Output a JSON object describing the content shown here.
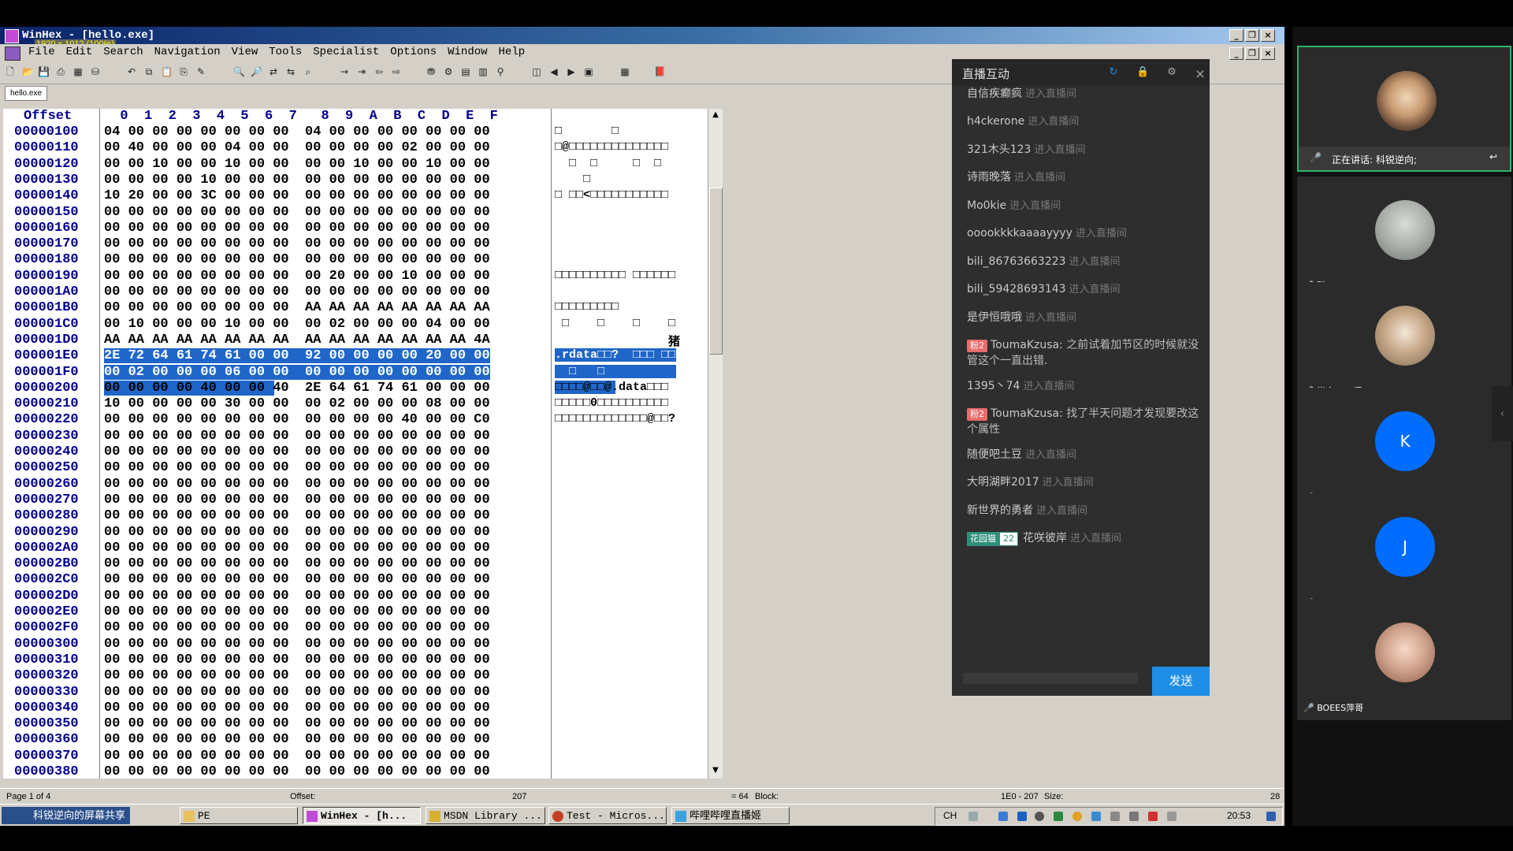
{
  "window": {
    "title": "WinHex - [hello.exe]",
    "size_info": "1920 x 1012 (100%)",
    "min": "_",
    "restore": "❐",
    "close": "×"
  },
  "menu": [
    "File",
    "Edit",
    "Search",
    "Navigation",
    "View",
    "Tools",
    "Specialist",
    "Options",
    "Window",
    "Help"
  ],
  "tab": "hello.exe",
  "hex_header": "Offset",
  "hex_columns": "  0  1  2  3  4  5  6  7   8  9  A  B  C  D  E  F",
  "rows": [
    {
      "off": "00000100",
      "hex": "04 00 00 00 00 00 00 00  04 00 00 00 00 00 00 00",
      "asc": "□       □"
    },
    {
      "off": "00000110",
      "hex": "00 40 00 00 00 04 00 00  00 00 00 00 02 00 00 00",
      "asc": "□@□□□□□□□□□□□□□□"
    },
    {
      "off": "00000120",
      "hex": "00 00 10 00 00 10 00 00  00 00 10 00 00 10 00 00",
      "asc": "  □  □     □  □"
    },
    {
      "off": "00000130",
      "hex": "00 00 00 00 10 00 00 00  00 00 00 00 00 00 00 00",
      "asc": "    □"
    },
    {
      "off": "00000140",
      "hex": "10 20 00 00 3C 00 00 00  00 00 00 00 00 00 00 00",
      "asc": "□ □□<□□□□□□□□□□□"
    },
    {
      "off": "00000150",
      "hex": "00 00 00 00 00 00 00 00  00 00 00 00 00 00 00 00",
      "asc": ""
    },
    {
      "off": "00000160",
      "hex": "00 00 00 00 00 00 00 00  00 00 00 00 00 00 00 00",
      "asc": ""
    },
    {
      "off": "00000170",
      "hex": "00 00 00 00 00 00 00 00  00 00 00 00 00 00 00 00",
      "asc": ""
    },
    {
      "off": "00000180",
      "hex": "00 00 00 00 00 00 00 00  00 00 00 00 00 00 00 00",
      "asc": ""
    },
    {
      "off": "00000190",
      "hex": "00 00 00 00 00 00 00 00  00 20 00 00 10 00 00 00",
      "asc": "□□□□□□□□□□ □□□□□□"
    },
    {
      "off": "000001A0",
      "hex": "00 00 00 00 00 00 00 00  00 00 00 00 00 00 00 00",
      "asc": ""
    },
    {
      "off": "000001B0",
      "hex": "00 00 00 00 00 00 00 00  AA AA AA AA AA AA AA AA",
      "asc": "□□□□□□□□□"
    },
    {
      "off": "000001C0",
      "hex": "00 10 00 00 00 10 00 00  00 02 00 00 00 04 00 00",
      "asc": " □    □    □    □"
    },
    {
      "off": "000001D0",
      "hex": "AA AA AA AA AA AA AA AA  AA AA AA AA AA AA AA 4A",
      "asc": "                猪"
    },
    {
      "off": "000001E0",
      "hex": "2E 72 64 61 74 61 00 00  92 00 00 00 00 20 00 00",
      "asc": ".rdata□□?  □□□ □□"
    },
    {
      "off": "000001F0",
      "hex": "00 02 00 00 00 06 00 00  00 00 00 00 00 00 00 00",
      "asc": "  □   □"
    },
    {
      "off": "00000200",
      "hex": "00 00 00 00 40 00 00 40  2E 64 61 74 61 00 00 00",
      "asc": "□□□□@□□@.data□□□"
    },
    {
      "off": "00000210",
      "hex": "10 00 00 00 00 30 00 00  00 02 00 00 00 08 00 00",
      "asc": "□□□□□0□□□□□□□□□□"
    },
    {
      "off": "00000220",
      "hex": "00 00 00 00 00 00 00 00  00 00 00 00 40 00 00 C0",
      "asc": "□□□□□□□□□□□□□@□□?"
    },
    {
      "off": "00000230",
      "hex": "00 00 00 00 00 00 00 00  00 00 00 00 00 00 00 00",
      "asc": ""
    },
    {
      "off": "00000240",
      "hex": "00 00 00 00 00 00 00 00  00 00 00 00 00 00 00 00",
      "asc": ""
    },
    {
      "off": "00000250",
      "hex": "00 00 00 00 00 00 00 00  00 00 00 00 00 00 00 00",
      "asc": ""
    },
    {
      "off": "00000260",
      "hex": "00 00 00 00 00 00 00 00  00 00 00 00 00 00 00 00",
      "asc": ""
    },
    {
      "off": "00000270",
      "hex": "00 00 00 00 00 00 00 00  00 00 00 00 00 00 00 00",
      "asc": ""
    },
    {
      "off": "00000280",
      "hex": "00 00 00 00 00 00 00 00  00 00 00 00 00 00 00 00",
      "asc": ""
    },
    {
      "off": "00000290",
      "hex": "00 00 00 00 00 00 00 00  00 00 00 00 00 00 00 00",
      "asc": ""
    },
    {
      "off": "000002A0",
      "hex": "00 00 00 00 00 00 00 00  00 00 00 00 00 00 00 00",
      "asc": ""
    },
    {
      "off": "000002B0",
      "hex": "00 00 00 00 00 00 00 00  00 00 00 00 00 00 00 00",
      "asc": ""
    },
    {
      "off": "000002C0",
      "hex": "00 00 00 00 00 00 00 00  00 00 00 00 00 00 00 00",
      "asc": ""
    },
    {
      "off": "000002D0",
      "hex": "00 00 00 00 00 00 00 00  00 00 00 00 00 00 00 00",
      "asc": ""
    },
    {
      "off": "000002E0",
      "hex": "00 00 00 00 00 00 00 00  00 00 00 00 00 00 00 00",
      "asc": ""
    },
    {
      "off": "000002F0",
      "hex": "00 00 00 00 00 00 00 00  00 00 00 00 00 00 00 00",
      "asc": ""
    },
    {
      "off": "00000300",
      "hex": "00 00 00 00 00 00 00 00  00 00 00 00 00 00 00 00",
      "asc": ""
    },
    {
      "off": "00000310",
      "hex": "00 00 00 00 00 00 00 00  00 00 00 00 00 00 00 00",
      "asc": ""
    },
    {
      "off": "00000320",
      "hex": "00 00 00 00 00 00 00 00  00 00 00 00 00 00 00 00",
      "asc": ""
    },
    {
      "off": "00000330",
      "hex": "00 00 00 00 00 00 00 00  00 00 00 00 00 00 00 00",
      "asc": ""
    },
    {
      "off": "00000340",
      "hex": "00 00 00 00 00 00 00 00  00 00 00 00 00 00 00 00",
      "asc": ""
    },
    {
      "off": "00000350",
      "hex": "00 00 00 00 00 00 00 00  00 00 00 00 00 00 00 00",
      "asc": ""
    },
    {
      "off": "00000360",
      "hex": "00 00 00 00 00 00 00 00  00 00 00 00 00 00 00 00",
      "asc": ""
    },
    {
      "off": "00000370",
      "hex": "00 00 00 00 00 00 00 00  00 00 00 00 00 00 00 00",
      "asc": ""
    },
    {
      "off": "00000380",
      "hex": "00 00 00 00 00 00 00 00  00 00 00 00 00 00 00 00",
      "asc": ""
    }
  ],
  "status": {
    "page": "Page 1 of 4",
    "offset_label": "Offset:",
    "offset_value": "207",
    "eq": "= 64",
    "block_label": "Block:",
    "block_value": "1E0 - 207",
    "size_label": "Size:",
    "size_value": "28"
  },
  "taskbar": {
    "start": "科锐逆向的屏幕共享",
    "items": [
      "PE",
      "WinHex - [h...",
      "MSDN Library ...",
      "Test - Micros...",
      "哔哩哔哩直播姬"
    ],
    "lang": "CH",
    "clock": "20:53"
  },
  "chat": {
    "title": "直播互动",
    "messages": [
      {
        "user": "自信疾癫疯",
        "action": "进入直播间"
      },
      {
        "user": "h4ckerone",
        "action": "进入直播间"
      },
      {
        "user": "321木头123",
        "action": "进入直播间"
      },
      {
        "user": "诗雨晚落",
        "action": "进入直播间"
      },
      {
        "user": "Mo0kie",
        "action": "进入直播间"
      },
      {
        "user": "ooookkkkaaaayyyy",
        "action": "进入直播间"
      },
      {
        "user": "bili_86763663223",
        "action": "进入直播间"
      },
      {
        "user": "bili_59428693143",
        "action": "进入直播间"
      },
      {
        "user": "是伊恒哦哦",
        "action": "进入直播间"
      },
      {
        "level": "粉2",
        "user": "ToumaKzusa:",
        "text": "之前试着加节区的时候就没管这个一直出错."
      },
      {
        "user": "1395丶74",
        "action": "进入直播间"
      },
      {
        "level": "粉2",
        "user": "ToumaKzusa:",
        "text": "找了半天问题才发现要改这个属性"
      },
      {
        "user": "随便吧土豆",
        "action": "进入直播间"
      },
      {
        "user": "大明湖畔2017",
        "action": "进入直播间"
      },
      {
        "user": "新世界的勇者",
        "action": "进入直播间"
      },
      {
        "badge": "花园猫",
        "badge_level": "22",
        "user": "花咲彼岸",
        "action": "进入直播间"
      }
    ],
    "send": "发送"
  },
  "participants": [
    {
      "name": "正在讲话: 科锐逆向;",
      "avatar": "photo-elder"
    },
    {
      "name": "聪",
      "avatar": "photo-grey"
    },
    {
      "name": "学会teng爱",
      "avatar": "photo-couple"
    },
    {
      "name": "kameiluo",
      "letter": "K"
    },
    {
      "name": "josores",
      "letter": "J"
    },
    {
      "name": "BOEES萍哥",
      "avatar": "photo-child"
    }
  ],
  "colors": {
    "selection": "#1f66c8",
    "offset_blue": "#00008b",
    "chat_bg": "#2e2e2e",
    "send_blue": "#1f8ee6",
    "avatar_blue": "#006dff",
    "active_border": "#2fb56a"
  }
}
